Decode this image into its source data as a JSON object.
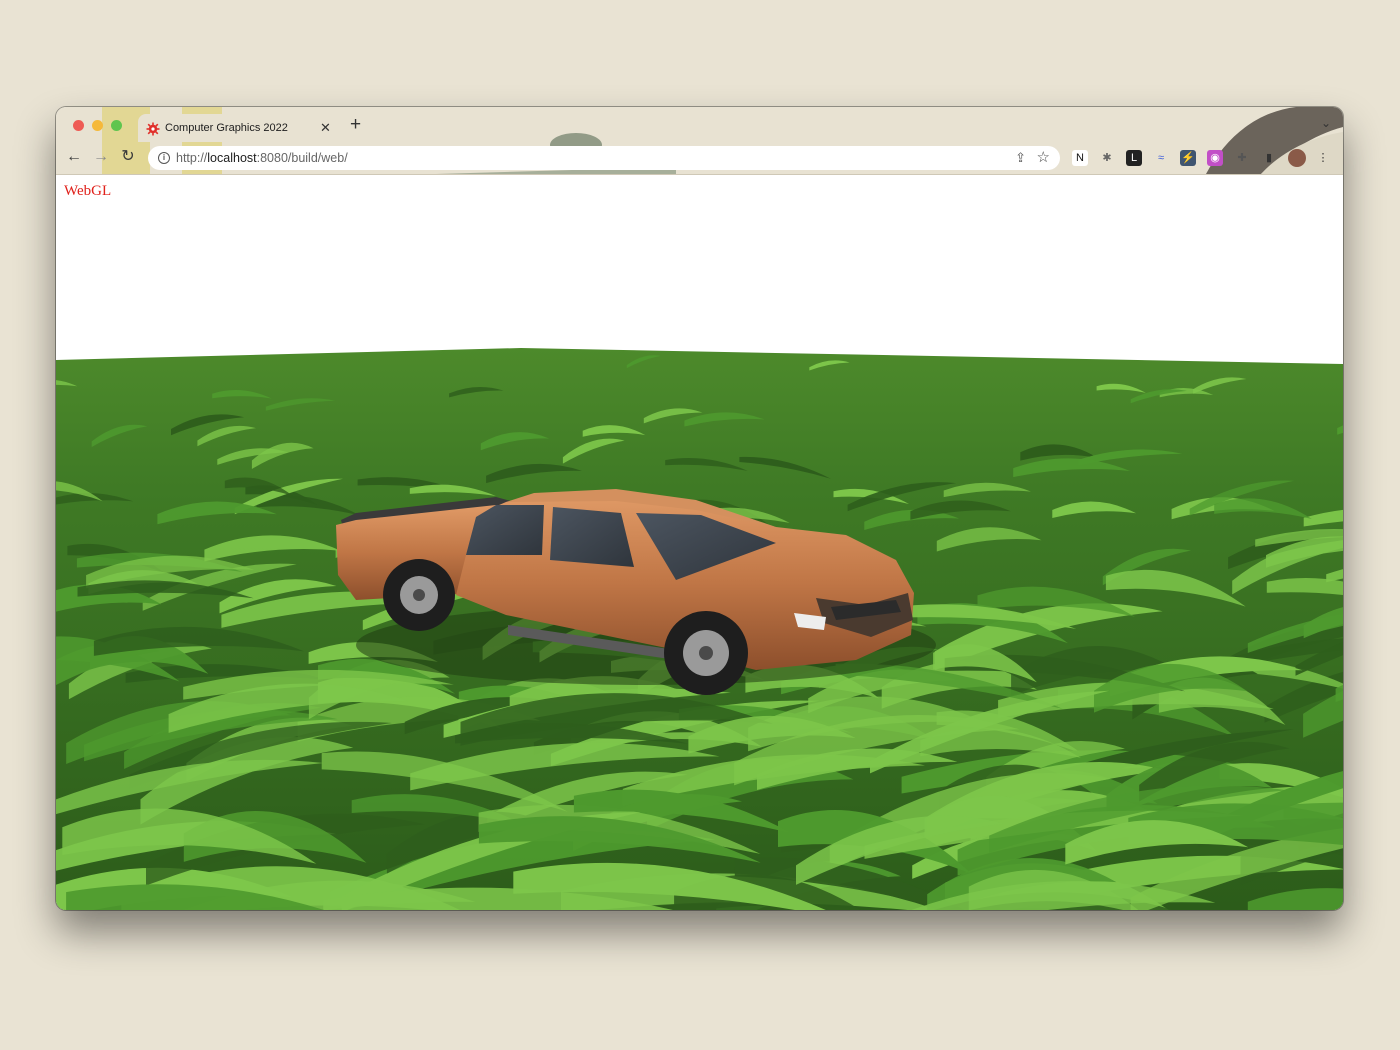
{
  "browser": {
    "tab": {
      "title": "Computer Graphics 2022",
      "close_glyph": "✕",
      "favicon": "gear-virus-icon",
      "favicon_color": "#e0302a"
    },
    "new_tab_glyph": "+",
    "tab_list_glyph": "⌄",
    "nav": {
      "back": "←",
      "forward": "→",
      "reload": "↻"
    },
    "address": {
      "scheme": "http://",
      "host": "localhost",
      "rest": ":8080/build/web/",
      "info_glyph": "i"
    },
    "address_actions": {
      "share": "⇪",
      "bookmark": "☆"
    },
    "extensions": [
      {
        "name": "notion-icon",
        "glyph": "N",
        "color": "#111111",
        "bg": "#ffffff"
      },
      {
        "name": "bug-icon",
        "glyph": "✱",
        "color": "#666666",
        "bg": "transparent"
      },
      {
        "name": "l-extension-icon",
        "glyph": "L",
        "color": "#ffffff",
        "bg": "#222222"
      },
      {
        "name": "wave-icon",
        "glyph": "≈",
        "color": "#3a5bd9",
        "bg": "transparent"
      },
      {
        "name": "bolt-icon",
        "glyph": "⚡",
        "color": "#ffffff",
        "bg": "#3f5570"
      },
      {
        "name": "robot-icon",
        "glyph": "◉",
        "color": "#ffffff",
        "bg": "#c24fc7"
      },
      {
        "name": "puzzle-icon",
        "glyph": "✚",
        "color": "#555555",
        "bg": "transparent"
      },
      {
        "name": "sidepanel-icon",
        "glyph": "▮",
        "color": "#333333",
        "bg": "transparent"
      },
      {
        "name": "avatar",
        "glyph": "",
        "color": "#7a4a3a",
        "bg": "#8a5a48"
      },
      {
        "name": "menu-icon",
        "glyph": "⋮",
        "color": "#333333",
        "bg": "transparent"
      }
    ]
  },
  "page": {
    "label": "WebGL",
    "label_color": "#e0201a",
    "scene": {
      "ground": "grass",
      "vehicle": "pickup-truck",
      "vehicle_color": "#c07646",
      "grass_colors": [
        "#2e5e1c",
        "#4e9a2e",
        "#7dc64a"
      ]
    }
  }
}
